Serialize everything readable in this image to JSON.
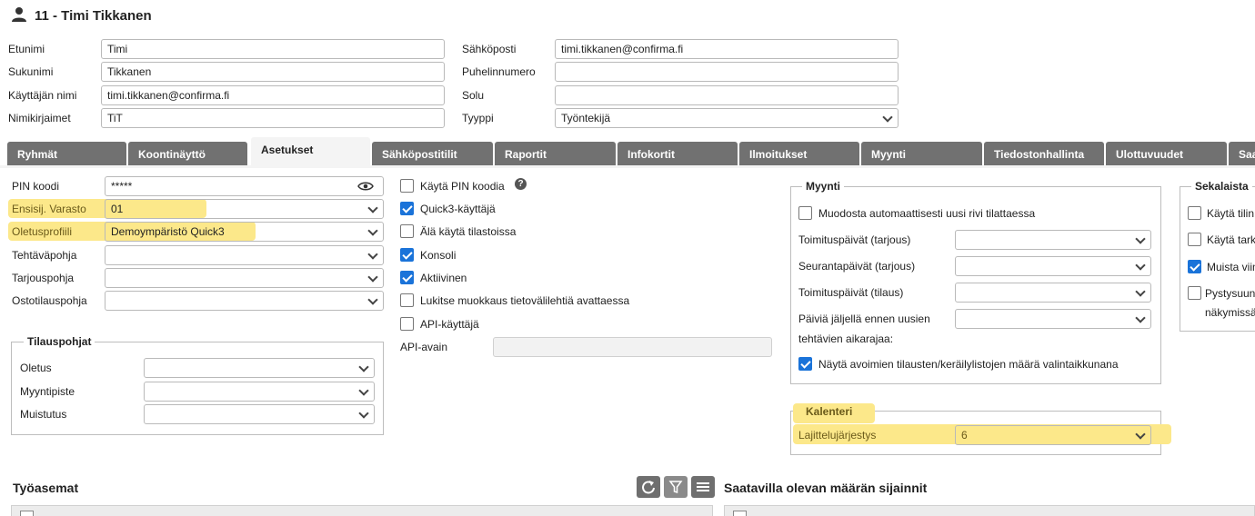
{
  "header": {
    "title": "11 - Timi Tikkanen",
    "icon": "person-icon"
  },
  "user_form": {
    "first_name": {
      "label": "Etunimi",
      "value": "Timi"
    },
    "last_name": {
      "label": "Sukunimi",
      "value": "Tikkanen"
    },
    "username": {
      "label": "Käyttäjän nimi",
      "value": "timi.tikkanen@confirma.fi"
    },
    "initials": {
      "label": "Nimikirjaimet",
      "value": "TiT"
    },
    "email": {
      "label": "Sähköposti",
      "value": "timi.tikkanen@confirma.fi"
    },
    "phone": {
      "label": "Puhelinnumero",
      "value": ""
    },
    "cell": {
      "label": "Solu",
      "value": ""
    },
    "type": {
      "label": "Tyyppi",
      "value": "Työntekijä"
    }
  },
  "tabs": [
    {
      "label": "Ryhmät",
      "active": false
    },
    {
      "label": "Koontinäyttö",
      "active": false
    },
    {
      "label": "Asetukset",
      "active": true
    },
    {
      "label": "Sähköpostitilit",
      "active": false
    },
    {
      "label": "Raportit",
      "active": false
    },
    {
      "label": "Infokortit",
      "active": false
    },
    {
      "label": "Ilmoitukset",
      "active": false
    },
    {
      "label": "Myynti",
      "active": false
    },
    {
      "label": "Tiedostonhallinta",
      "active": false
    },
    {
      "label": "Ulottuvuudet",
      "active": false
    },
    {
      "label": "Saa",
      "active": false
    }
  ],
  "settings": {
    "pin": {
      "label": "PIN koodi",
      "value": "*****",
      "icon": "eye-icon"
    },
    "warehouse": {
      "label": "Ensisij. Varasto",
      "value": "01"
    },
    "profile": {
      "label": "Oletusprofiili",
      "value": "Demoympäristö Quick3"
    },
    "task_template": {
      "label": "Tehtäväpohja",
      "value": ""
    },
    "offer_template": {
      "label": "Tarjouspohja",
      "value": ""
    },
    "purchase_template": {
      "label": "Ostotilauspohja",
      "value": ""
    }
  },
  "order_templates": {
    "legend": "Tilauspohjat",
    "default": {
      "label": "Oletus",
      "value": ""
    },
    "sales_point": {
      "label": "Myyntipiste",
      "value": ""
    },
    "reminder": {
      "label": "Muistutus",
      "value": ""
    }
  },
  "checkboxes": [
    {
      "label": "Käytä PIN koodia",
      "checked": false,
      "help_icon": "help-icon"
    },
    {
      "label": "Quick3-käyttäjä",
      "checked": true
    },
    {
      "label": "Älä käytä tilastoissa",
      "checked": false
    },
    {
      "label": "Konsoli",
      "checked": true
    },
    {
      "label": "Aktiivinen",
      "checked": true
    },
    {
      "label": "Lukitse muokkaus tietovälilehtiä avattaessa",
      "checked": false
    },
    {
      "label": "API-käyttäjä",
      "checked": false
    }
  ],
  "api_key": {
    "label": "API-avain",
    "value": ""
  },
  "sales": {
    "legend": "Myynti",
    "auto_row": {
      "label": "Muodosta automaattisesti uusi rivi tilattaessa",
      "checked": false
    },
    "delivery_days_offer": {
      "label": "Toimituspäivät (tarjous)",
      "value": ""
    },
    "followup_days_offer": {
      "label": "Seurantapäivät (tarjous)",
      "value": ""
    },
    "delivery_days_order": {
      "label": "Toimituspäivät (tilaus)",
      "value": ""
    },
    "days_left_line1": "Päiviä jäljellä ennen uusien",
    "days_left_line2": "tehtävien aikarajaa:",
    "days_left_value": "",
    "show_open": {
      "label": "Näytä avoimien tilausten/keräilylistojen määrä valintaikkunana",
      "checked": true
    }
  },
  "calendar": {
    "legend": "Kalenteri",
    "sort_order": {
      "label": "Lajittelujärjestys",
      "value": "6"
    }
  },
  "misc": {
    "legend": "Sekalaista",
    "items": [
      {
        "label": "Käytä tilin",
        "checked": false
      },
      {
        "label": "Käytä tark",
        "checked": false
      },
      {
        "label": "Muista viim",
        "checked": true
      },
      {
        "label": "Pystysuun",
        "label2": "näkymissä",
        "checked": false
      }
    ]
  },
  "workstations": {
    "title": "Työasemat",
    "refresh_icon": "refresh-icon",
    "filter_icon": "filter-icon",
    "menu_icon": "menu-icon"
  },
  "locations": {
    "title": "Saatavilla olevan määrän sijainnit"
  },
  "colors": {
    "tab_bg": "#717171",
    "highlight": "#fbe99a",
    "checkbox_on": "#1a73d9"
  }
}
